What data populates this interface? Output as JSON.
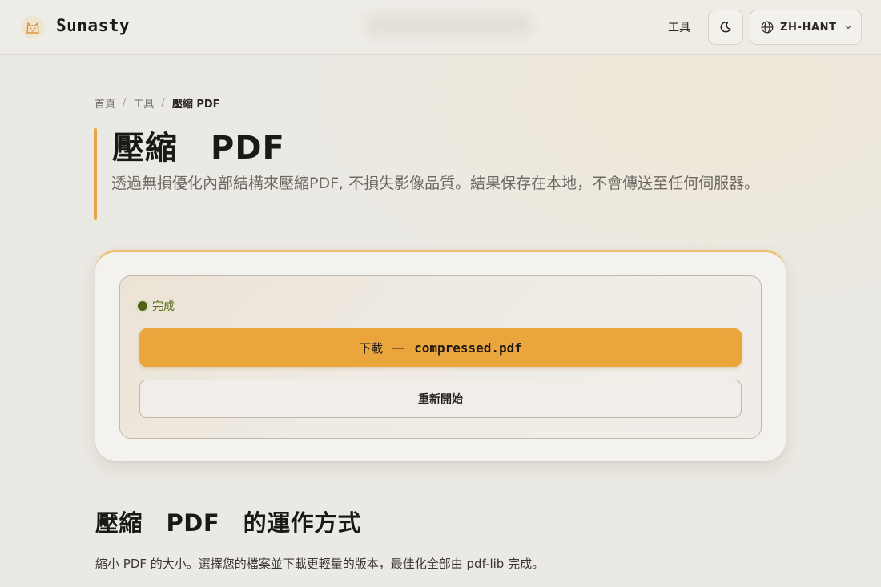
{
  "header": {
    "brand": "Sunasty",
    "nav_tools": "工具",
    "theme_icon": "moon-icon",
    "language": "ZH-HANT"
  },
  "breadcrumb": {
    "home": "首頁",
    "tools": "工具",
    "current": "壓縮 PDF",
    "separator": "/"
  },
  "page": {
    "title": "壓縮　PDF",
    "subtitle": "透過無損優化內部結構來壓縮PDF, 不損失影像品質。結果保存在本地，不會傳送至任何伺服器。"
  },
  "result": {
    "status": "完成",
    "download_prefix": "下載",
    "download_dash": "—",
    "download_filename": "compressed.pdf",
    "restart_label": "重新開始"
  },
  "how_it_works": {
    "title": "壓縮　PDF　的運作方式",
    "text": "縮小 PDF 的大小。選擇您的檔案並下載更輕量的版本，最佳化全部由 pdf-lib 完成。"
  },
  "colors": {
    "accent": "#eba53d",
    "status_green": "#4f6019",
    "background": "#ebe9e3"
  }
}
